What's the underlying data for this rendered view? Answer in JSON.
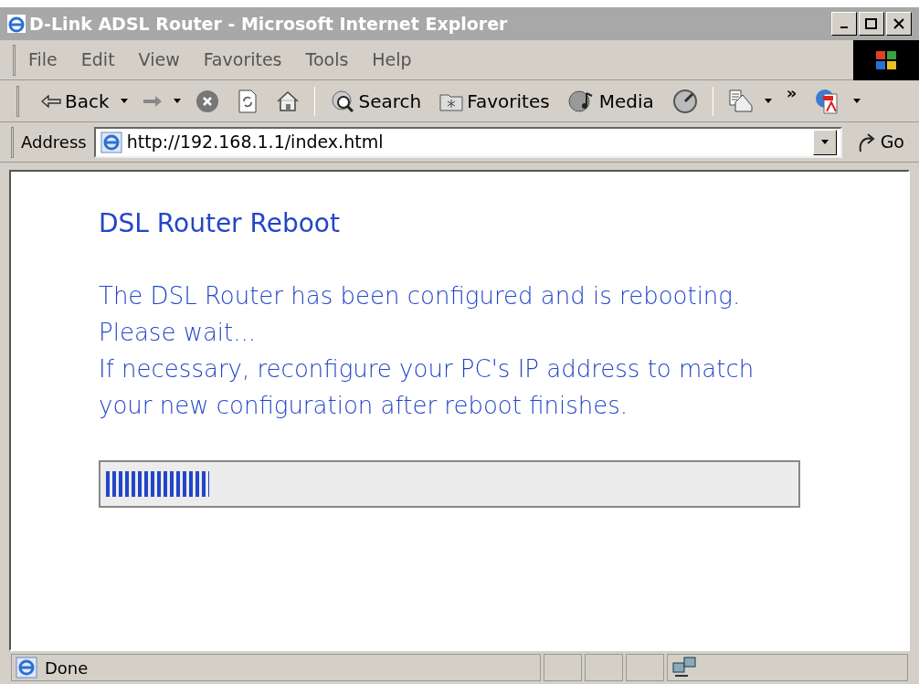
{
  "window": {
    "title": "D-Link ADSL Router - Microsoft Internet Explorer"
  },
  "menu": [
    "File",
    "Edit",
    "View",
    "Favorites",
    "Tools",
    "Help"
  ],
  "toolbar": [
    {
      "kind": "back",
      "label": "Back"
    },
    {
      "kind": "forward"
    },
    {
      "kind": "stop"
    },
    {
      "kind": "refresh"
    },
    {
      "kind": "home"
    },
    {
      "kind": "search",
      "label": "Search"
    },
    {
      "kind": "favorites",
      "label": "Favorites"
    },
    {
      "kind": "media",
      "label": "Media"
    },
    {
      "kind": "history"
    },
    {
      "kind": "mail"
    },
    {
      "kind": "more",
      "label": "»"
    },
    {
      "kind": "pdf"
    }
  ],
  "address": {
    "label": "Address",
    "value": "http://192.168.1.1/index.html",
    "go": "Go"
  },
  "page": {
    "heading": "DSL Router Reboot",
    "lines": [
      "The DSL Router has been configured and is rebooting.",
      "Please wait...",
      "If necessary, reconfigure your PC's IP address to match",
      "your new configuration after reboot finishes."
    ],
    "progress": {
      "level": 0.15
    }
  },
  "status_bar": {
    "text": "Done"
  }
}
